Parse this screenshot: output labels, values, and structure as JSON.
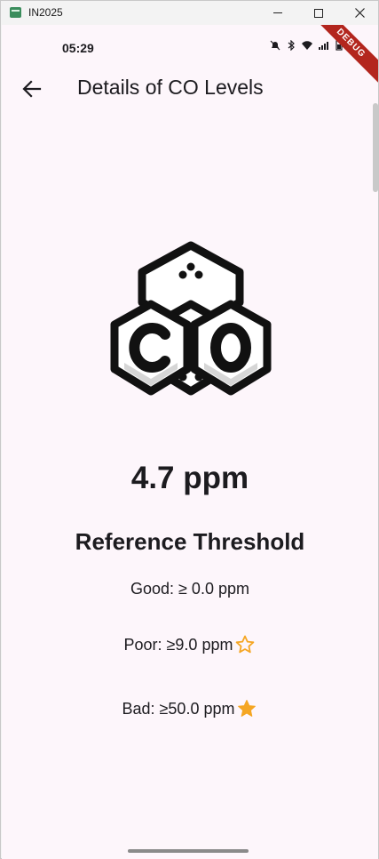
{
  "window": {
    "title": "IN2025",
    "minimize": "minimize",
    "maximize": "maximize",
    "close": "close"
  },
  "status": {
    "time": "05:29",
    "debug_label": "DEBUG"
  },
  "appbar": {
    "title": "Details of CO Levels"
  },
  "logo": {
    "text": "CO"
  },
  "reading": {
    "value": "4.7 ppm"
  },
  "thresholds": {
    "title": "Reference Threshold",
    "good": "Good: ≥ 0.0 ppm",
    "poor": "Poor: ≥9.0 ppm",
    "bad": "Bad: ≥50.0 ppm"
  },
  "colors": {
    "background": "#fdf6fb",
    "star": "#f5a623",
    "text": "#1c1b1f",
    "debug": "#b3261e"
  },
  "icons": [
    "back-arrow-icon",
    "star-outline-icon",
    "star-filled-icon",
    "co-logo-icon",
    "mute-icon",
    "bluetooth-icon",
    "wifi-icon",
    "signal-icon",
    "battery-icon"
  ]
}
